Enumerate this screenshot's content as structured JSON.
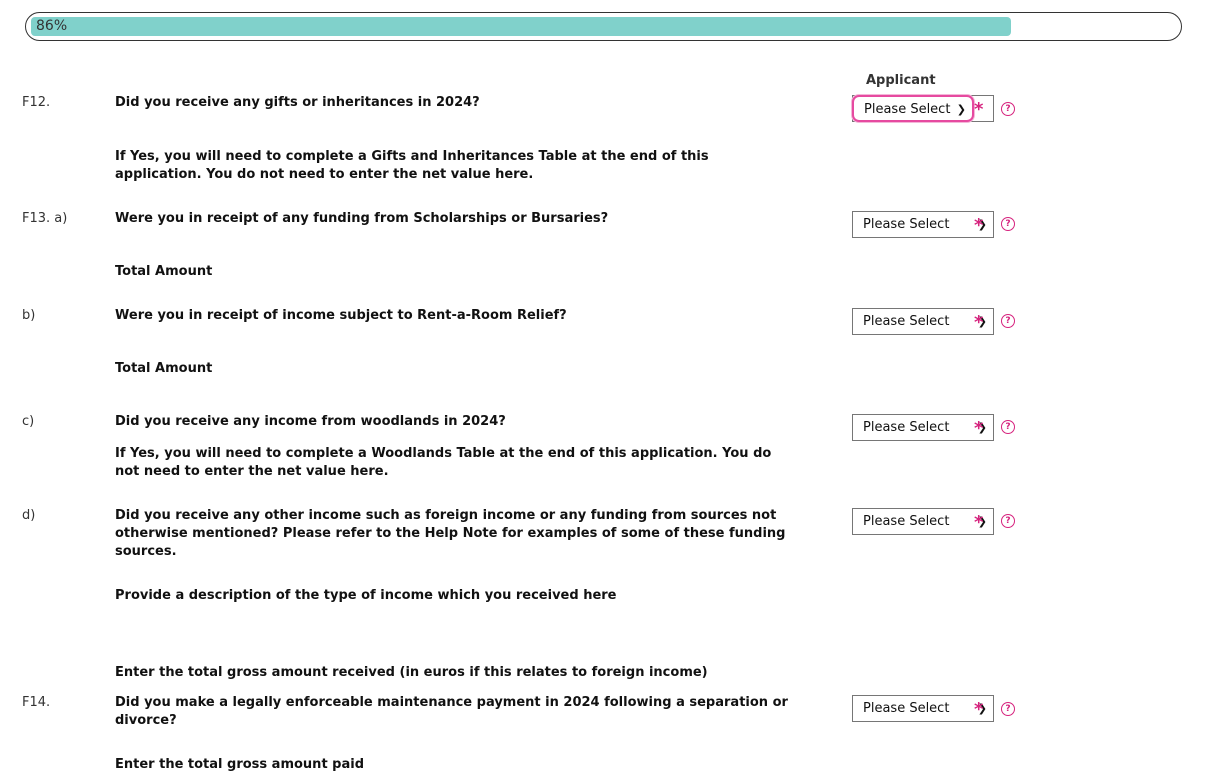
{
  "progress": {
    "percent": 86,
    "label": "86%"
  },
  "column_header": "Applicant",
  "select_default": "Please Select",
  "required_mark": "*",
  "help_glyph": "?",
  "rows": {
    "f12": {
      "num": "F12.",
      "question": "Did you receive any gifts or inheritances in 2024?",
      "note": "If Yes, you will need to complete a Gifts and Inheritances Table at the end of this application. You do not need to enter the net value here."
    },
    "f13a": {
      "num": "F13. a)",
      "question": "Were you in receipt of any funding from Scholarships or Bursaries?",
      "total": "Total Amount"
    },
    "b": {
      "num": "b)",
      "question": "Were you in receipt of income subject to Rent-a-Room Relief?",
      "total": "Total Amount"
    },
    "c": {
      "num": "c)",
      "question": "Did you receive any income from woodlands in 2024?",
      "note": "If Yes, you will need to complete a Woodlands Table at the end of this application. You do not need to enter the net value here."
    },
    "d": {
      "num": "d)",
      "question": "Did you receive any other income such as foreign income or any funding from sources not otherwise mentioned? Please refer to the Help Note for examples of some of these funding sources.",
      "description": "Provide a description of the type of income which you received here",
      "gross": "Enter the total gross amount received (in euros if this relates to foreign income)"
    },
    "f14": {
      "num": "F14.",
      "question": "Did you make a legally enforceable maintenance payment in 2024 following a separation or divorce?",
      "total": "Enter the total gross amount paid"
    }
  }
}
